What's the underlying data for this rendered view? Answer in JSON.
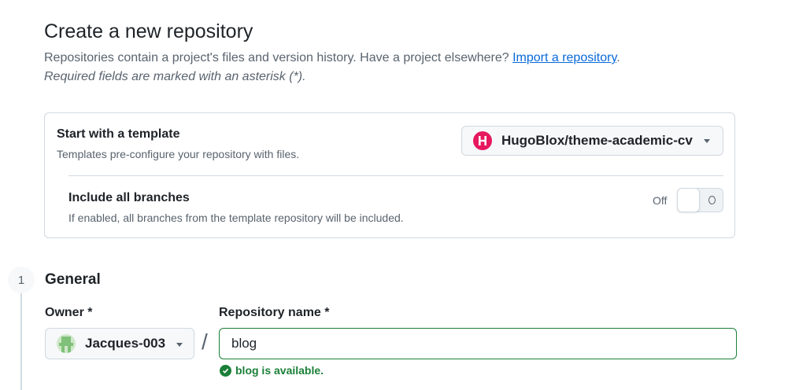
{
  "header": {
    "title": "Create a new repository",
    "intro_text": "Repositories contain a project's files and version history. Have a project elsewhere?",
    "import_link": "Import a repository",
    "intro_period": ".",
    "required_note": "Required fields are marked with an asterisk (*)."
  },
  "template": {
    "title": "Start with a template",
    "description": "Templates pre-configure your repository with files.",
    "selected": "HugoBlox/theme-academic-cv",
    "logo_icon": "hugoblox-h-icon",
    "include_branches": {
      "title": "Include all branches",
      "description": "If enabled, all branches from the template repository will be included.",
      "state_label": "Off",
      "enabled": false
    }
  },
  "general": {
    "step_number": "1",
    "title": "General",
    "owner_label": "Owner *",
    "owner_value": "Jacques-003",
    "separator": "/",
    "repo_name_label": "Repository name *",
    "repo_name_value": "blog",
    "availability": "blog is available."
  },
  "colors": {
    "link": "#0969da",
    "success": "#1a7f37",
    "hugoblox_brand": "#e6195e",
    "border": "#d1d9e0",
    "muted_text": "#59636e"
  }
}
